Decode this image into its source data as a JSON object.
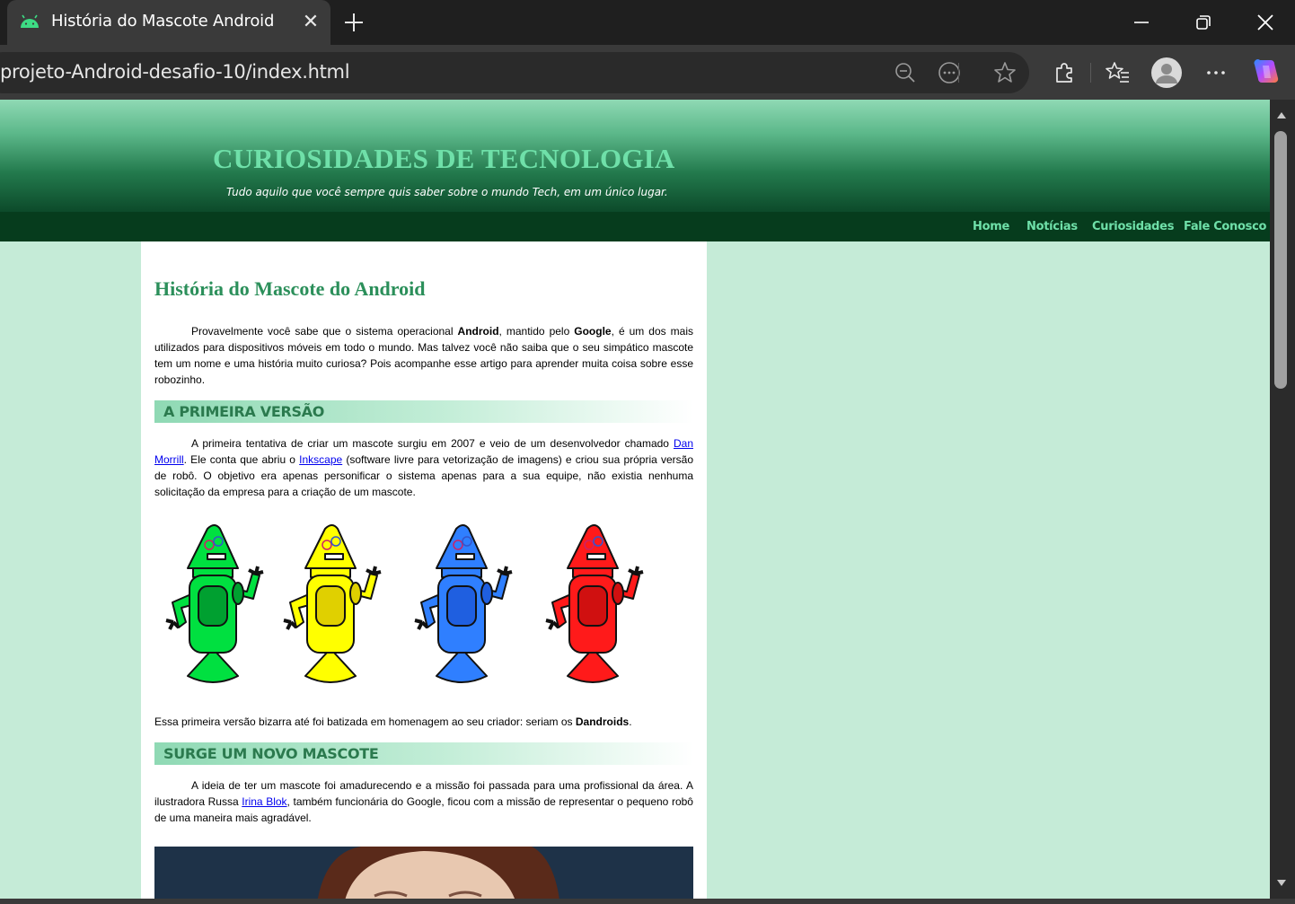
{
  "browser": {
    "tab_title": "História do Mascote Android",
    "tab_close": "✕",
    "url": "projeto-Android-desafio-10/index.html"
  },
  "site": {
    "title": "CURIOSIDADES DE TECNOLOGIA",
    "subtitle": "Tudo aquilo que você sempre quis saber sobre o mundo Tech, em um único lugar.",
    "nav": [
      "Home",
      "Notícias",
      "Curiosidades",
      "Fale Conosco"
    ]
  },
  "article": {
    "title": "História do Mascote do Android",
    "intro": {
      "t1": "Provavelmente você sabe que o sistema operacional ",
      "b1": "Android",
      "t2": ", mantido pelo ",
      "b2": "Google",
      "t3": ", é um dos mais utilizados para dispositivos móveis em todo o mundo. Mas talvez você não saiba que o seu simpático mascote tem um nome e uma história muito curiosa? Pois acompanhe esse artigo para aprender muita coisa sobre esse robozinho."
    },
    "section1": {
      "heading": "A PRIMEIRA VERSÃO",
      "t1": "A primeira tentativa de criar um mascote surgiu em 2007 e veio de um desenvolvedor chamado ",
      "link1": "Dan Morrill",
      "t2": ". Ele conta que abriu o ",
      "link2": "Inkscape",
      "t3": " (software livre para vetorização de imagens) e criou sua própria versão de robô. O objetivo era apenas personificar o sistema apenas para a sua equipe, não existia nenhuma solicitação da empresa para a criação de um mascote."
    },
    "caption": {
      "t1": "Essa primeira versão bizarra até foi batizada em homenagem ao seu criador: seriam os ",
      "b1": "Dandroids",
      "t2": "."
    },
    "section2": {
      "heading": "SURGE UM NOVO MASCOTE",
      "t1": "A ideia de ter um mascote foi amadurecendo e a missão foi passada para uma profissional da área. A ilustradora Russa ",
      "link1": "Irina Blok",
      "t2": ", também funcionária do Google, ficou com a missão de representar o pequeno robô de uma maneira mais agradável."
    }
  },
  "colors": {
    "robots": [
      "#00e040",
      "#ffff00",
      "#2f7fff",
      "#ff1a1a"
    ],
    "robots_dark": [
      "#00a030",
      "#e0d000",
      "#1f5fe0",
      "#d01010"
    ],
    "accent_text": "#2b8f5a",
    "nav_text": "#6fe0a9",
    "page_bg": "#c5ebd7"
  }
}
